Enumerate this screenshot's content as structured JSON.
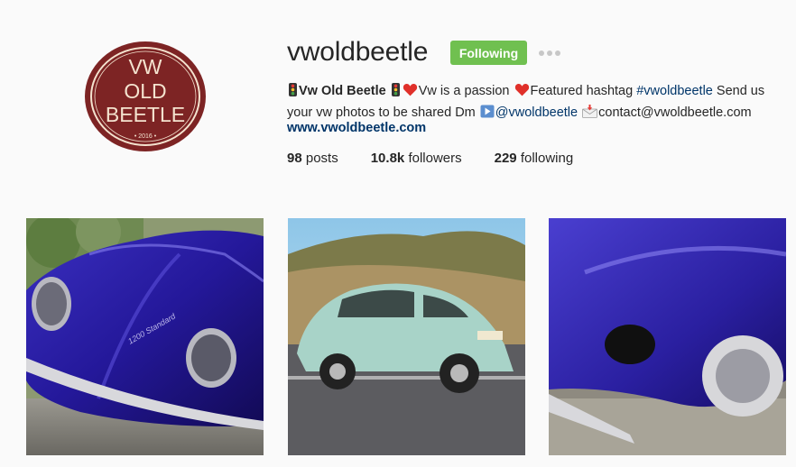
{
  "profile": {
    "username": "vwoldbeetle",
    "follow_label": "Following",
    "more_icon": "ellipsis-icon",
    "avatar": {
      "line1": "VW",
      "line2": "OLD",
      "line3": "BEETLE",
      "year": "• 2016 •",
      "colors": {
        "bg": "#7d2424",
        "ring": "#f4e3cf",
        "text": "#f4e3cf"
      }
    },
    "bio": {
      "name": "Vw Old Beetle",
      "tagline": "Vw is a passion",
      "featured_text": "Featured hashtag",
      "hashtag": "#vwoldbeetle",
      "send_text": "Send us your vw photos to be shared Dm",
      "mention": "@vwoldbeetle",
      "email": "contact@vwoldbeetle.com"
    },
    "website": "www.vwoldbeetle.com",
    "stats": {
      "posts_count": "98",
      "posts_label": "posts",
      "followers_count": "10.8k",
      "followers_label": "followers",
      "following_count": "229",
      "following_label": "following"
    }
  },
  "colors": {
    "follow_button": "#70c050",
    "link": "#003569",
    "beetle_blue": "#2a1fa0",
    "beetle_mint": "#a8d3c8"
  },
  "posts": [
    {
      "icon": "photo-blue-beetle-front",
      "script_badge": "1200 Standard"
    },
    {
      "icon": "photo-mint-beetle-driving"
    },
    {
      "icon": "photo-blue-beetle-fender-closeup"
    }
  ]
}
